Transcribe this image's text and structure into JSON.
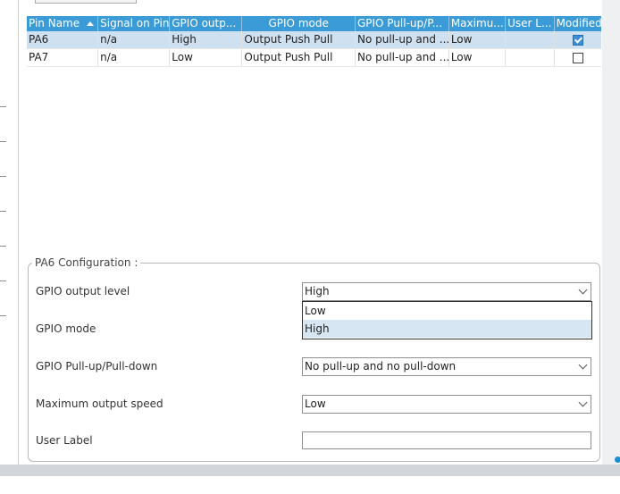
{
  "table": {
    "columns": [
      "Pin Name",
      "Signal on Pin",
      "GPIO outp...",
      "GPIO mode",
      "GPIO Pull-up/P...",
      "Maximu...",
      "User L...",
      "Modified"
    ],
    "rows": [
      {
        "pin": "PA6",
        "signal": "n/a",
        "output": "High",
        "mode": "Output Push Pull",
        "pull": "No pull-up and ...",
        "speed": "Low",
        "user_label": "",
        "modified": true
      },
      {
        "pin": "PA7",
        "signal": "n/a",
        "output": "Low",
        "mode": "Output Push Pull",
        "pull": "No pull-up and ...",
        "speed": "Low",
        "user_label": "",
        "modified": false
      }
    ]
  },
  "config": {
    "title": "PA6 Configuration :",
    "output_level": {
      "label": "GPIO output level",
      "value": "High",
      "options": [
        "Low",
        "High"
      ],
      "highlighted": "High"
    },
    "mode": {
      "label": "GPIO mode"
    },
    "pull": {
      "label": "GPIO Pull-up/Pull-down",
      "value": "No pull-up and no pull-down"
    },
    "speed": {
      "label": "Maximum output speed",
      "value": "Low"
    },
    "user_label": {
      "label": "User Label",
      "value": ""
    }
  },
  "colors": {
    "header": "#3b9bd6",
    "selected_row": "#cfe0f0",
    "checkbox_on": "#3b8ed6"
  }
}
